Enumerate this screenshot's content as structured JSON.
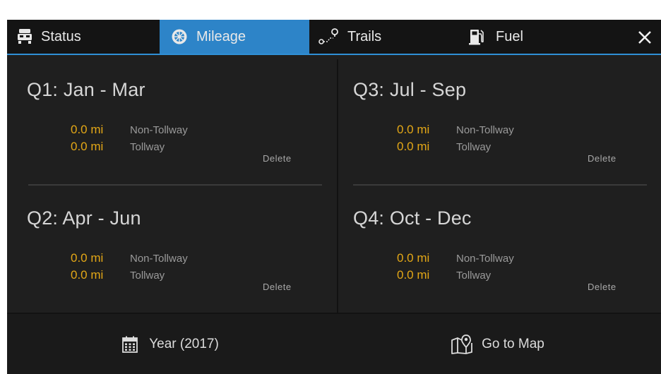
{
  "tabs": {
    "status": {
      "label": "Status",
      "icon": "truck-icon"
    },
    "mileage": {
      "label": "Mileage",
      "icon": "wheel-icon"
    },
    "trails": {
      "label": "Trails",
      "icon": "route-pin-icon"
    },
    "fuel": {
      "label": "Fuel",
      "icon": "fuel-pump-icon"
    },
    "active": "mileage"
  },
  "close_icon": "close-icon",
  "quarters": [
    {
      "title": "Q1: Jan - Mar",
      "non_tollway_value": "0.0 mi",
      "non_tollway_label": "Non-Tollway",
      "tollway_value": "0.0 mi",
      "tollway_label": "Tollway",
      "delete_label": "Delete"
    },
    {
      "title": "Q2: Apr - Jun",
      "non_tollway_value": "0.0 mi",
      "non_tollway_label": "Non-Tollway",
      "tollway_value": "0.0 mi",
      "tollway_label": "Tollway",
      "delete_label": "Delete"
    },
    {
      "title": "Q3: Jul - Sep",
      "non_tollway_value": "0.0 mi",
      "non_tollway_label": "Non-Tollway",
      "tollway_value": "0.0 mi",
      "tollway_label": "Tollway",
      "delete_label": "Delete"
    },
    {
      "title": "Q4: Oct - Dec",
      "non_tollway_value": "0.0 mi",
      "non_tollway_label": "Non-Tollway",
      "tollway_value": "0.0 mi",
      "tollway_label": "Tollway",
      "delete_label": "Delete"
    }
  ],
  "bottom": {
    "year_label": "Year (2017)",
    "year_icon": "calendar-icon",
    "map_label": "Go to Map",
    "map_icon": "map-pin-icon"
  },
  "colors": {
    "accent": "#2d84c8",
    "mileage_value": "#e3a716",
    "background": "#1f1f1f"
  }
}
